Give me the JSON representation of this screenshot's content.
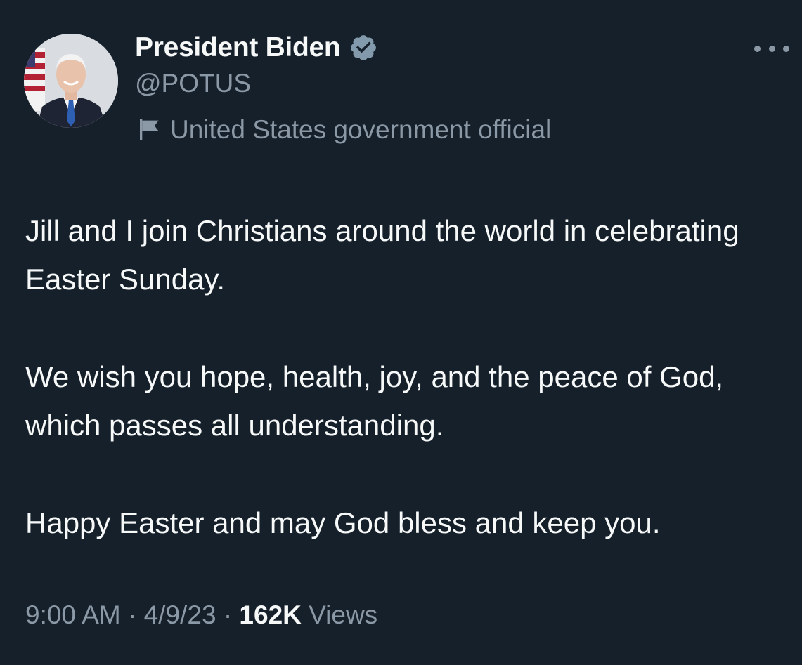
{
  "author": {
    "name": "President Biden",
    "handle": "@POTUS",
    "verified_icon": "verified-badge-icon",
    "label": "United States government official",
    "label_icon": "flag-icon"
  },
  "tweet": {
    "paragraphs": [
      "Jill and I join Christians around the world in celebrating Easter Sunday.",
      "We wish you hope, health, joy, and the peace of God, which passes all understanding.",
      "Happy Easter and may God bless and keep you."
    ],
    "time": "9:00 AM",
    "date": "4/9/23",
    "separator": "·",
    "views_count": "162K",
    "views_label": "Views"
  },
  "colors": {
    "background": "#15202b",
    "primary_text": "#f7f9f9",
    "secondary_text": "#8b98a5",
    "verified_badge": "#829aab"
  },
  "icons": {
    "more": "more-options-icon"
  }
}
